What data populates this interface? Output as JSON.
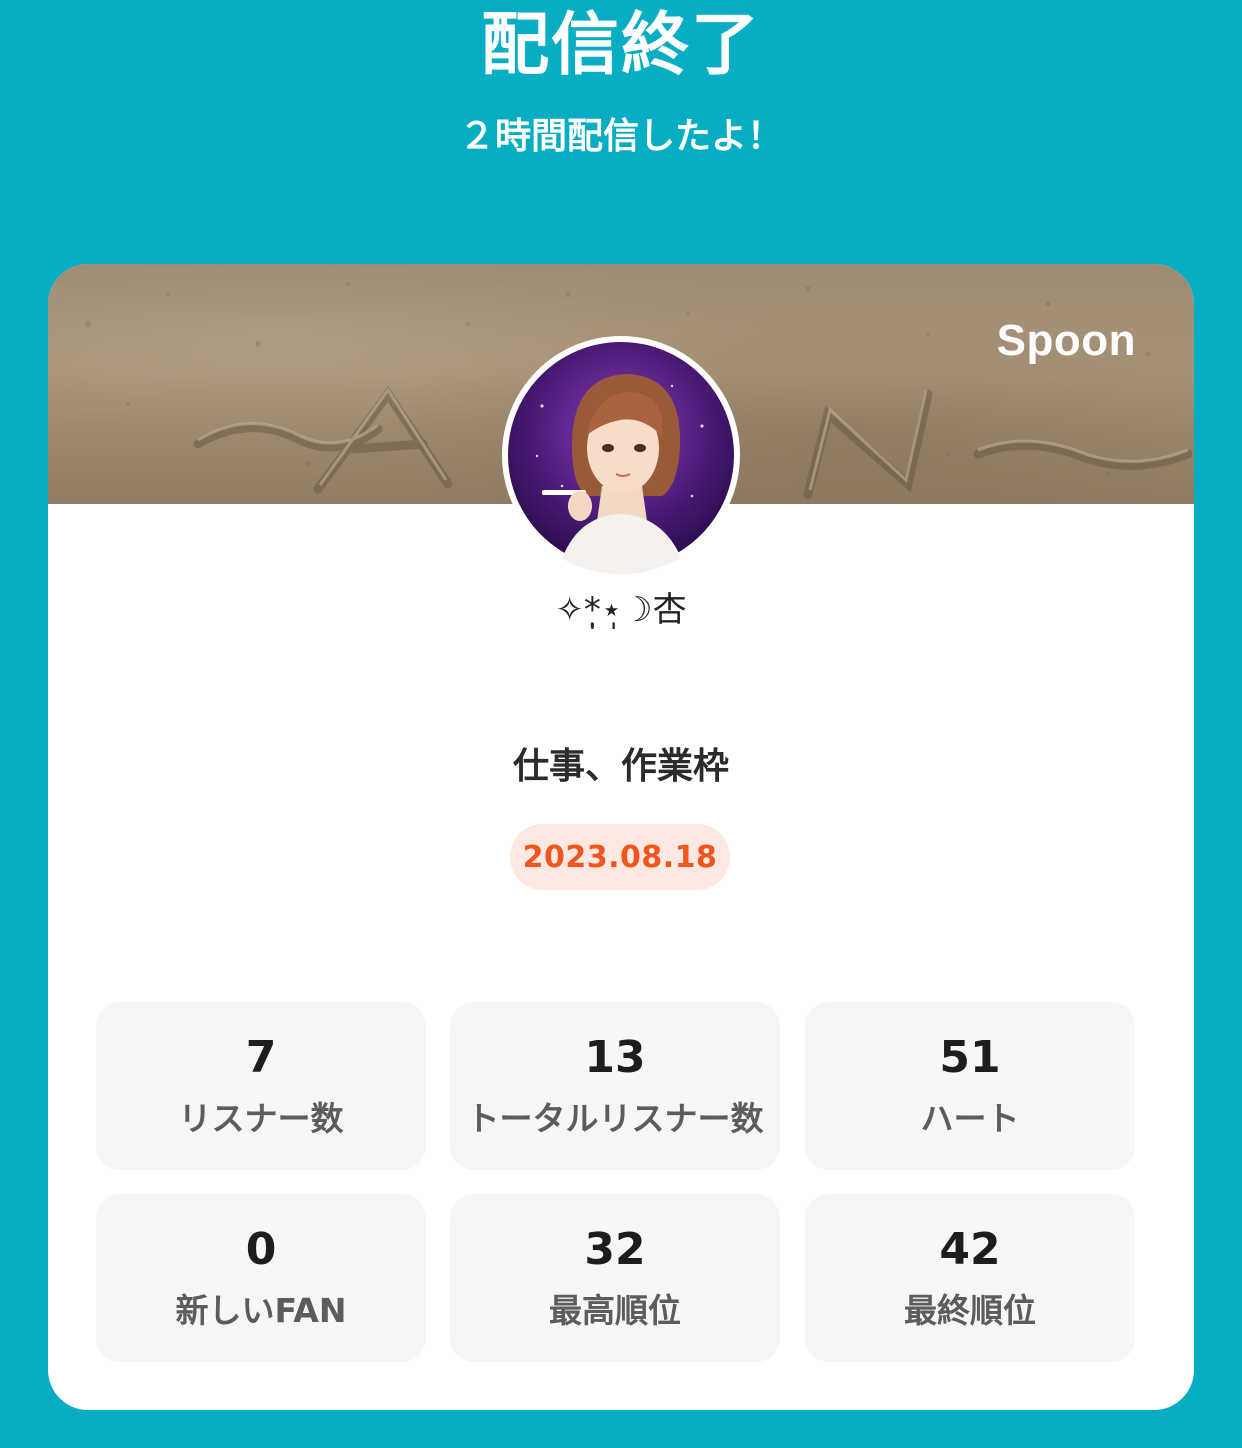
{
  "header": {
    "title": "配信終了",
    "subtitle": "２時間配信したよ！"
  },
  "card": {
    "brand": "Spoon",
    "username": "✧*̣̩⋆̩☽杏",
    "stream_title": "仕事、作業枠",
    "date": "2023.08.18"
  },
  "stats": [
    {
      "value": "7",
      "label": "リスナー数"
    },
    {
      "value": "13",
      "label": "トータルリスナー数"
    },
    {
      "value": "51",
      "label": "ハート"
    },
    {
      "value": "0",
      "label": "新しいFAN"
    },
    {
      "value": "32",
      "label": "最高順位"
    },
    {
      "value": "42",
      "label": "最終順位"
    }
  ],
  "colors": {
    "background": "#07adc3",
    "date_text": "#f1541f",
    "date_badge": "#fde8e1"
  }
}
